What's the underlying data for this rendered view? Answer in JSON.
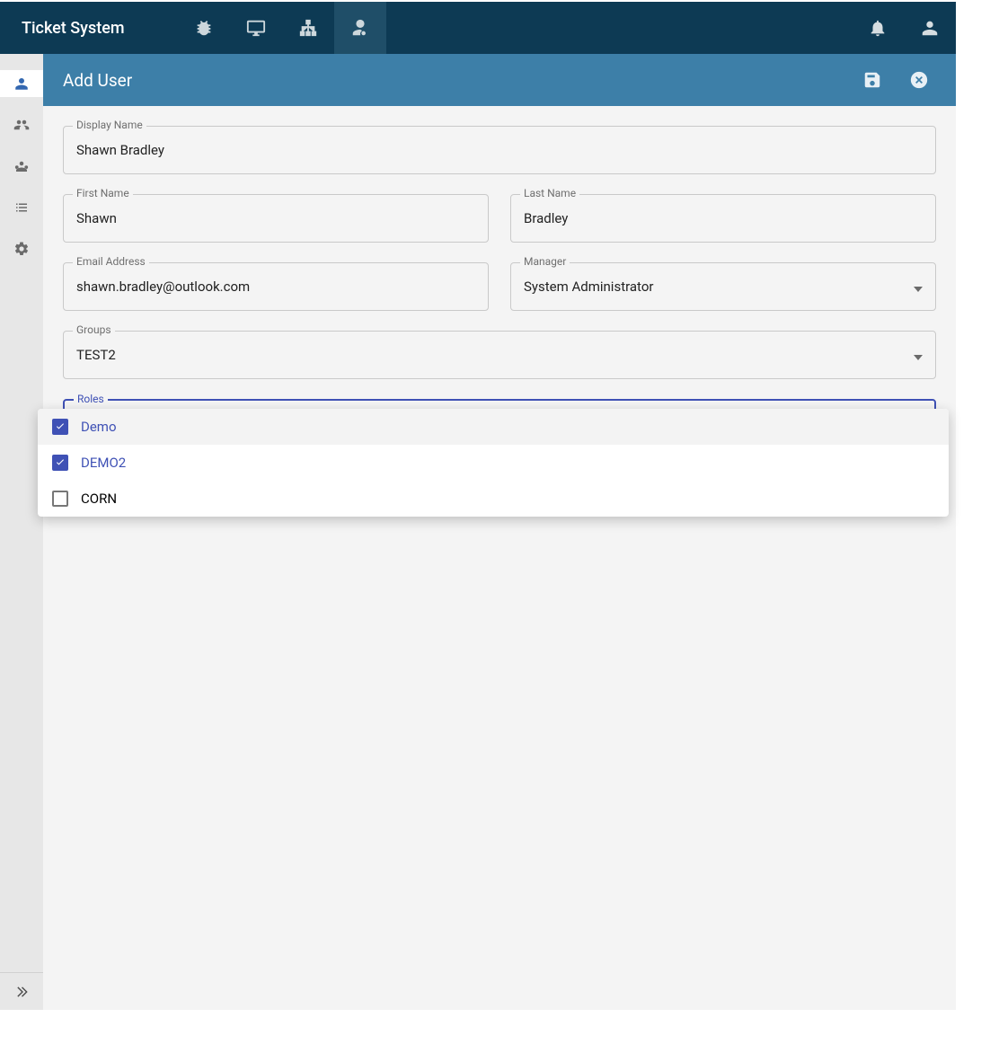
{
  "app": {
    "title": "Ticket System"
  },
  "page": {
    "title": "Add User"
  },
  "form": {
    "display_name": {
      "label": "Display Name",
      "value": "Shawn Bradley"
    },
    "first_name": {
      "label": "First Name",
      "value": "Shawn"
    },
    "last_name": {
      "label": "Last Name",
      "value": "Bradley"
    },
    "email": {
      "label": "Email Address",
      "value": "shawn.bradley@outlook.com"
    },
    "manager": {
      "label": "Manager",
      "value": "System Administrator"
    },
    "groups": {
      "label": "Groups",
      "value": "TEST2"
    },
    "roles": {
      "label": "Roles",
      "options": [
        {
          "label": "Demo",
          "checked": true
        },
        {
          "label": "DEMO2",
          "checked": true
        },
        {
          "label": "CORN",
          "checked": false
        }
      ]
    }
  }
}
